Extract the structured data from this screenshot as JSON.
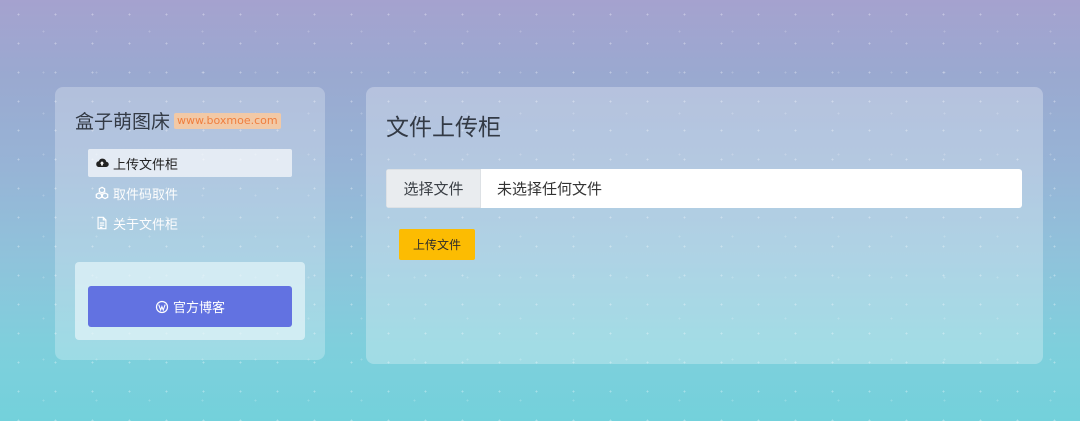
{
  "brand": {
    "title": "盒子萌图床",
    "url": "www.boxmoe.com"
  },
  "sidebar": {
    "items": [
      {
        "label": "上传文件柜",
        "icon": "cloud-upload-icon",
        "active": true
      },
      {
        "label": "取件码取件",
        "icon": "cubes-icon",
        "active": false
      },
      {
        "label": "关于文件柜",
        "icon": "file-text-icon",
        "active": false
      }
    ]
  },
  "blog": {
    "label": "官方博客",
    "icon": "wordpress-icon"
  },
  "main": {
    "title": "文件上传柜",
    "file_input": {
      "button_label": "选择文件",
      "status": "未选择任何文件"
    },
    "upload_button": "上传文件"
  },
  "colors": {
    "blog_button": "#6272e1",
    "upload_button": "#fcbc02",
    "brand_url": "#f07e3e"
  }
}
